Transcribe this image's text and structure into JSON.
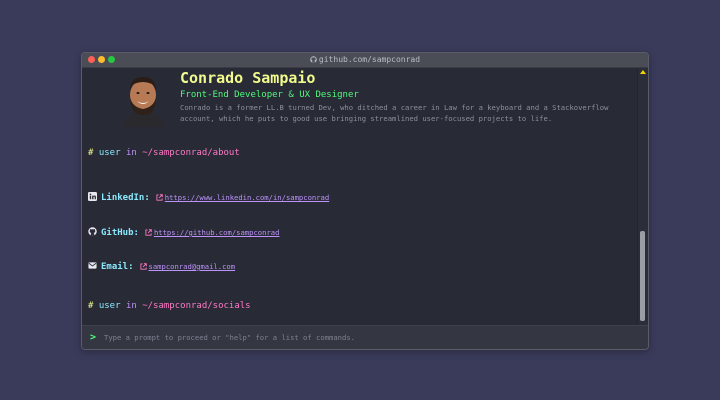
{
  "browser": {
    "url": "github.com/sampconrad"
  },
  "profile": {
    "name": "Conrado Sampaio",
    "role": "Front-End Developer & UX Designer",
    "bio": "Conrado is a former LL.B turned Dev, who ditched a career in Law for a keyboard and a Stackoverflow account, which he puts to good use bringing streamlined user-focused projects to life."
  },
  "prompts": [
    {
      "hash": "#",
      "user": "user",
      "in": "in",
      "path": "~/sampconrad/about"
    },
    {
      "hash": "#",
      "user": "user",
      "in": "in",
      "path": "~/sampconrad/socials"
    }
  ],
  "socials": [
    {
      "icon": "linkedin-icon",
      "label": "LinkedIn:",
      "url": "https://www.linkedin.com/in/sampconrad"
    },
    {
      "icon": "github-icon",
      "label": "GitHub:",
      "url": "https://github.com/sampconrad"
    },
    {
      "icon": "email-icon",
      "label": "Email:",
      "url": "sampconrad@gmail.com"
    }
  ],
  "input": {
    "caret": ">",
    "placeholder": "Type a prompt to proceed or \"help\" for a list of commands.",
    "value": ""
  },
  "colors": {
    "background": "#3a3a5a",
    "terminal": "#282a36",
    "name": "#f1fa8c",
    "role": "#50fa7b",
    "label": "#8be9fd",
    "link": "#bd93f9",
    "path": "#ff79c6"
  }
}
